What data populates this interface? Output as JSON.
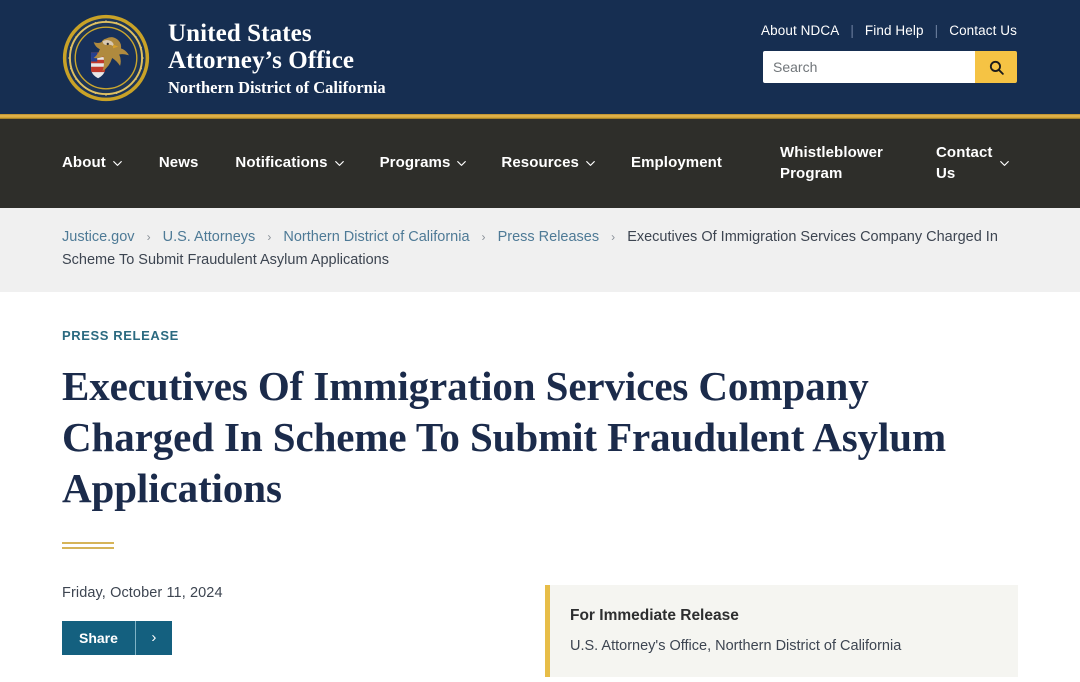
{
  "header": {
    "seal_icon": "doj-seal-icon",
    "brand_line1": "United States",
    "brand_line2": "Attorney’s Office",
    "brand_line3": "Northern District of California",
    "util_links": [
      {
        "label": "About NDCA"
      },
      {
        "label": "Find Help"
      },
      {
        "label": "Contact Us"
      }
    ],
    "separator": "|",
    "search": {
      "placeholder": "Search",
      "value": "",
      "button_icon": "search-icon"
    }
  },
  "nav": {
    "items": [
      {
        "label": "About",
        "has_caret": true
      },
      {
        "label": "News",
        "has_caret": false
      },
      {
        "label": "Notifications",
        "has_caret": true
      },
      {
        "label": "Programs",
        "has_caret": true
      },
      {
        "label": "Resources",
        "has_caret": true
      },
      {
        "label": "Employment",
        "has_caret": false
      },
      {
        "label": "Whistleblower\nProgram",
        "has_caret": false
      },
      {
        "label": "Contact\nUs",
        "has_caret": true
      }
    ],
    "caret_icon": "chevron-down-icon"
  },
  "breadcrumb": {
    "separator": "›",
    "items": [
      {
        "label": "Justice.gov",
        "is_link": true
      },
      {
        "label": "U.S. Attorneys",
        "is_link": true
      },
      {
        "label": "Northern District of California",
        "is_link": true
      },
      {
        "label": "Press Releases",
        "is_link": true
      },
      {
        "label": "Executives Of Immigration Services Company Charged In Scheme To Submit Fraudulent Asylum Applications",
        "is_link": false
      }
    ]
  },
  "article": {
    "eyebrow": "PRESS RELEASE",
    "headline": "Executives Of Immigration Services Company Charged In Scheme To Submit Fraudulent Asylum Applications",
    "date": "Friday, October 11, 2024",
    "share_label": "Share",
    "share_chevron": "›",
    "release_title": "For Immediate Release",
    "release_subtitle": "U.S. Attorney's Office, Northern District of California"
  },
  "colors": {
    "header_navy": "#162e51",
    "nav_charcoal": "#2e2e2a",
    "gold_rule": "#d4a22c",
    "search_button_gold": "#f5c344",
    "eyebrow_teal": "#2b6a80",
    "headline_navy": "#1b2b4b",
    "breadcrumb_link": "#4e7a96",
    "breadcrumb_band": "#f0f0f0",
    "share_button_blue": "#14607f",
    "release_box_bg": "#f5f5f1",
    "release_accent_gold": "#e7bd48"
  }
}
